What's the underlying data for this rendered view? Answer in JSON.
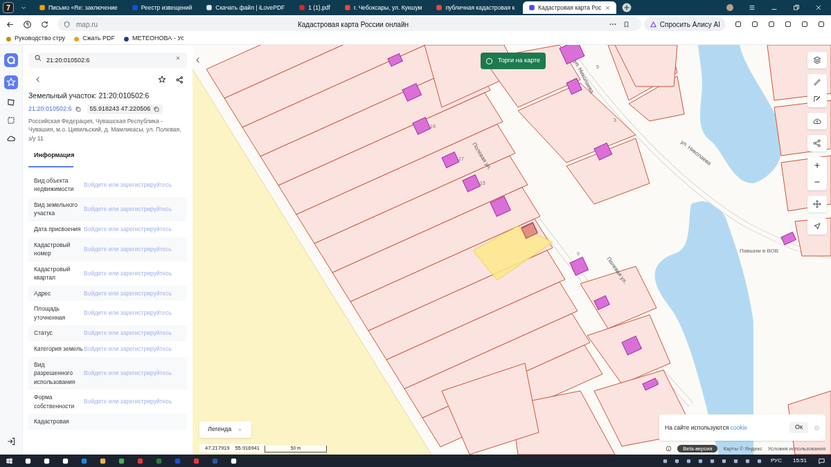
{
  "browser": {
    "tabs": [
      {
        "title": "Письмо «Re: заключение",
        "selected": false
      },
      {
        "title": "Реестр извещений",
        "selected": false
      },
      {
        "title": "Скачать файл | iLovePDF",
        "selected": false
      },
      {
        "title": "1 (1).pdf",
        "selected": false
      },
      {
        "title": "г. Чебоксары, ул. Кукшум",
        "selected": false
      },
      {
        "title": "публичная кадастровая к",
        "selected": false
      },
      {
        "title": "Кадастровая карта Рос",
        "selected": true
      }
    ],
    "tab_counter": "7",
    "address": "map.ru",
    "page_title": "Кадастровая карта России онлайн",
    "alice_button": "Спросить Алису AI",
    "bookmarks": [
      "Руководство стру",
      "Сжать PDF",
      "МЕТЕОНОВА - Ус"
    ]
  },
  "sidebar": {
    "search": {
      "value": "21:20:010502:6"
    },
    "title": "Земельный участок: 21:20:010502:6",
    "cadastral_number": "21:20:010502:6",
    "coordinates": "55.918243 47.220506",
    "address": "Российская Федерация, Чувашская Республика - Чувашия, м.о. Цивильский, д. Мамликасы, ул. Полевая, з/у 11",
    "tabs": [
      {
        "label": "Информация",
        "selected": true
      }
    ],
    "rows": [
      {
        "label": "Вид объекта недвижимости",
        "value": "Войдите или зарегистрируйтесь"
      },
      {
        "label": "Вид земельного участка",
        "value": "Войдите или зарегистрируйтесь"
      },
      {
        "label": "Дата присвоения",
        "value": "Войдите или зарегистрируйтесь"
      },
      {
        "label": "Кадастровый номер",
        "value": "Войдите или зарегистрируйтесь"
      },
      {
        "label": "Кадастровый квартал",
        "value": "Войдите или зарегистрируйтесь"
      },
      {
        "label": "Адрес",
        "value": "Войдите или зарегистрируйтесь"
      },
      {
        "label": "Площадь уточненная",
        "value": "Войдите или зарегистрируйтесь"
      },
      {
        "label": "Статус",
        "value": "Войдите или зарегистрируйтесь"
      },
      {
        "label": "Категория земель",
        "value": "Войдите или зарегистрируйтесь"
      },
      {
        "label": "Вид разрешенного использования",
        "value": "Войдите или зарегистрируйтесь"
      },
      {
        "label": "Форма собственности",
        "value": "Войдите или зарегистрируйтесь"
      },
      {
        "label": "Кадастровая",
        "value": ""
      }
    ]
  },
  "map": {
    "auction_toggle": {
      "label": "Торги на карте",
      "checked": false
    },
    "labels": [
      {
        "kind": "street",
        "text": "ул. Николаева"
      },
      {
        "kind": "street",
        "text": "ул. Николаева"
      },
      {
        "kind": "street",
        "text": "Полевая ул."
      },
      {
        "kind": "street",
        "text": "Полевая ул."
      },
      {
        "kind": "house",
        "text": "19"
      },
      {
        "kind": "house",
        "text": "17"
      },
      {
        "kind": "house",
        "text": "15"
      },
      {
        "kind": "house",
        "text": "9"
      },
      {
        "kind": "house",
        "text": "3"
      },
      {
        "kind": "house",
        "text": "5"
      },
      {
        "kind": "house",
        "text": "1"
      },
      {
        "kind": "poi",
        "text": "Павшим в ВОВ"
      }
    ],
    "legend": "Легенда",
    "cursor_lon": "47.217919",
    "cursor_lat": "55.916941",
    "scale": "50 m",
    "beta": "Beta-версия",
    "attribution": "Карты © Яндекс",
    "terms": "Условия использования",
    "cookie": {
      "text": "На сайте используются",
      "link": "cookie",
      "button": "Ок"
    }
  },
  "taskbar": {
    "language": "РУС",
    "time": "15:51"
  }
}
